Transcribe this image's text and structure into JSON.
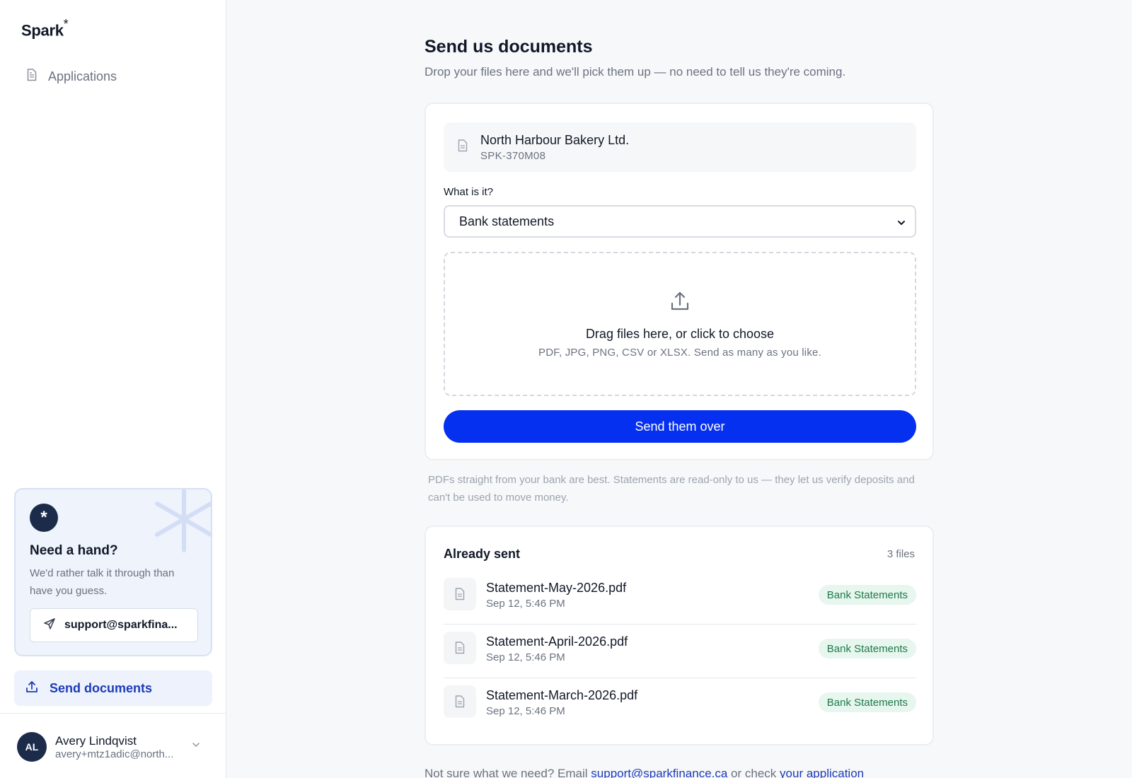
{
  "sidebar": {
    "logo": "Spark",
    "logo_mark": "*",
    "nav": [
      {
        "label": "Applications",
        "icon": "document-icon"
      }
    ],
    "help": {
      "icon": "asterisk-icon",
      "title": "Need a hand?",
      "text": "We'd rather talk it through than have you guess.",
      "email": "support@sparkfina..."
    },
    "send_documents": {
      "label": "Send documents",
      "icon": "upload-icon"
    },
    "user": {
      "initials": "AL",
      "name": "Avery Lindqvist",
      "email": "avery+mtz1adic@north..."
    }
  },
  "main": {
    "title": "Send us documents",
    "subtitle": "Drop your files here and we'll pick them up — no need to tell us they're coming.",
    "application": {
      "name": "North Harbour Bakery Ltd.",
      "id": "SPK-370M08"
    },
    "type_label": "What is it?",
    "type_value": "Bank statements",
    "dropzone": {
      "title": "Drag files here, or click to choose",
      "subtitle": "PDF, JPG, PNG, CSV or XLSX. Send as many as you like."
    },
    "send_button": "Send them over",
    "note": "PDFs straight from your bank are best. Statements are read-only to us — they let us verify deposits and can't be used to move money.",
    "already_sent": {
      "title": "Already sent",
      "count": "3 files",
      "files": [
        {
          "name": "Statement-May-2026.pdf",
          "date": "Sep 12, 5:46 PM",
          "tag": "Bank Statements"
        },
        {
          "name": "Statement-April-2026.pdf",
          "date": "Sep 12, 5:46 PM",
          "tag": "Bank Statements"
        },
        {
          "name": "Statement-March-2026.pdf",
          "date": "Sep 12, 5:46 PM",
          "tag": "Bank Statements"
        }
      ]
    },
    "footer": {
      "prefix": "Not sure what we need? Email ",
      "email": "support@sparkfinance.ca",
      "middle": " or check ",
      "link": "your application"
    }
  },
  "colors": {
    "accent": "#0530f0",
    "nav_active": "#1d3bb8",
    "badge_bg": "#e7f6ee",
    "badge_text": "#1f7a4a",
    "avatar": "#1c2b4a"
  }
}
